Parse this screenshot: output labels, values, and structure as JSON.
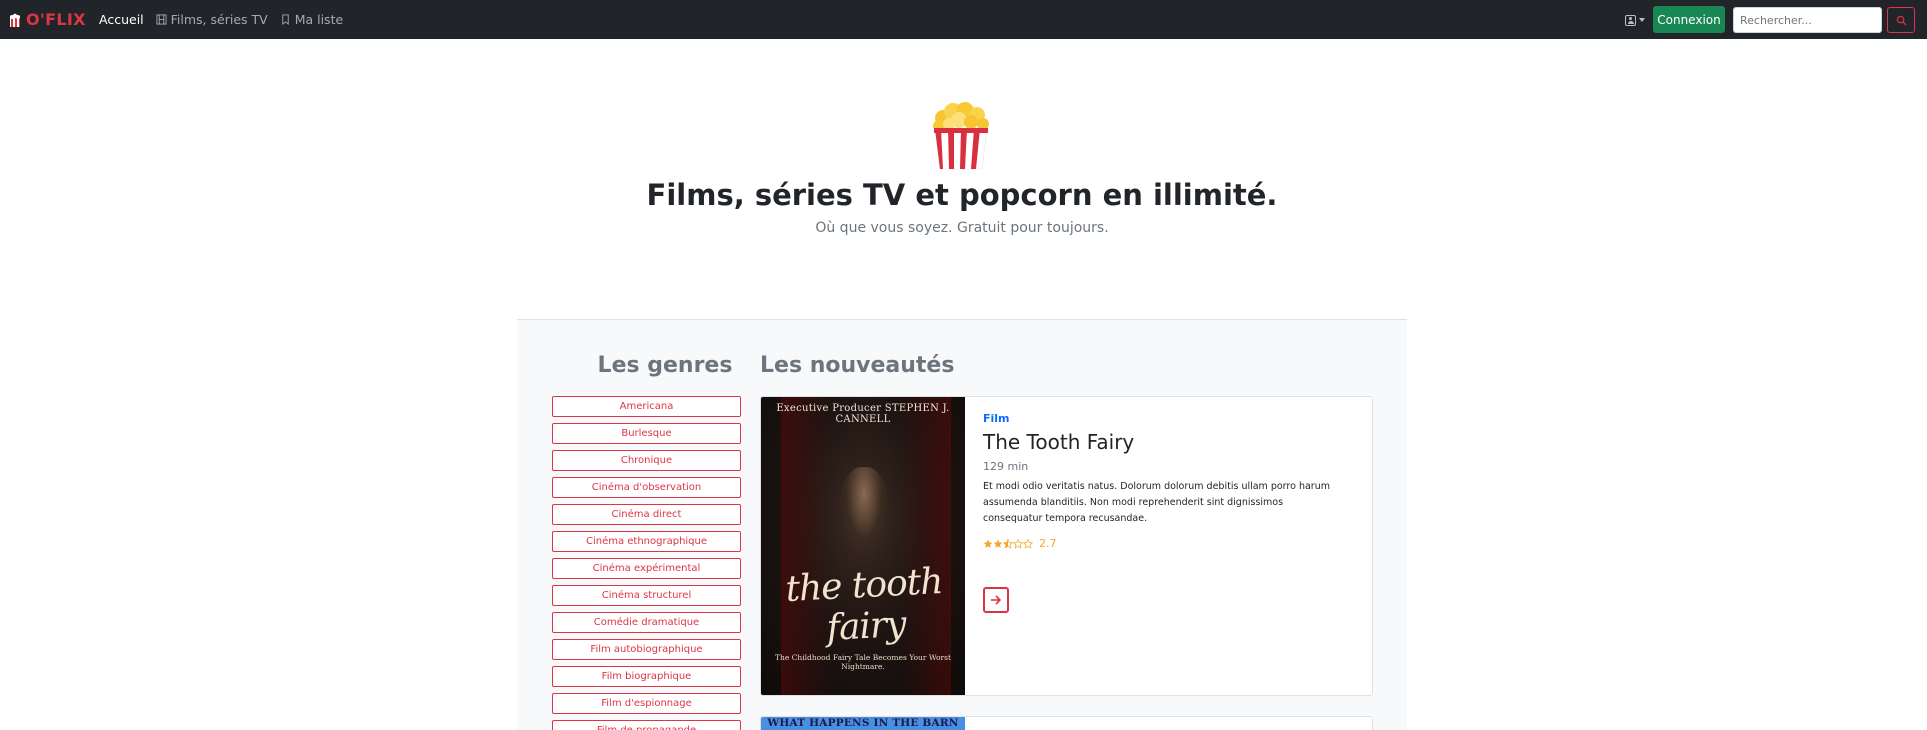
{
  "navbar": {
    "brand": "O'FLIX",
    "links": [
      {
        "label": "Accueil",
        "active": true
      },
      {
        "label": "Films, séries TV",
        "icon": "film-icon"
      },
      {
        "label": "Ma liste",
        "icon": "bookmark-icon"
      }
    ],
    "login_label": "Connexion",
    "search_placeholder": "Rechercher..."
  },
  "hero": {
    "title": "Films, séries TV et popcorn en illimité.",
    "subtitle": "Où que vous soyez. Gratuit pour toujours."
  },
  "genres": {
    "title": "Les genres",
    "items": [
      "Americana",
      "Burlesque",
      "Chronique",
      "Cinéma d'observation",
      "Cinéma direct",
      "Cinéma ethnographique",
      "Cinéma expérimental",
      "Cinéma structurel",
      "Comédie dramatique",
      "Film autobiographique",
      "Film biographique",
      "Film d'espionnage",
      "Film de propagande"
    ]
  },
  "news": {
    "title": "Les nouveautés",
    "cards": [
      {
        "kind": "Film",
        "title": "The Tooth Fairy",
        "duration": "129 min",
        "synopsis": "Et modi odio veritatis natus. Dolorum dolorum debitis ullam porro harum assumenda blanditiis. Non modi reprehenderit sint dignissimos consequatur tempora recusandae.",
        "rating": 2.7,
        "rating_label": "2.7",
        "poster": {
          "top": "Executive Producer STEPHEN J. CANNELL",
          "title": "the tooth fairy",
          "tag": "The Childhood Fairy Tale Becomes Your Worst Nightmare."
        }
      },
      {
        "poster": {
          "title": "WHAT HAPPENS IN THE BARN"
        }
      }
    ]
  },
  "colors": {
    "navbar_bg": "#212529",
    "brand_red": "#dc3545",
    "login_green": "#198754",
    "kind_blue": "#0d6efd",
    "star_gold": "#f5a623"
  }
}
